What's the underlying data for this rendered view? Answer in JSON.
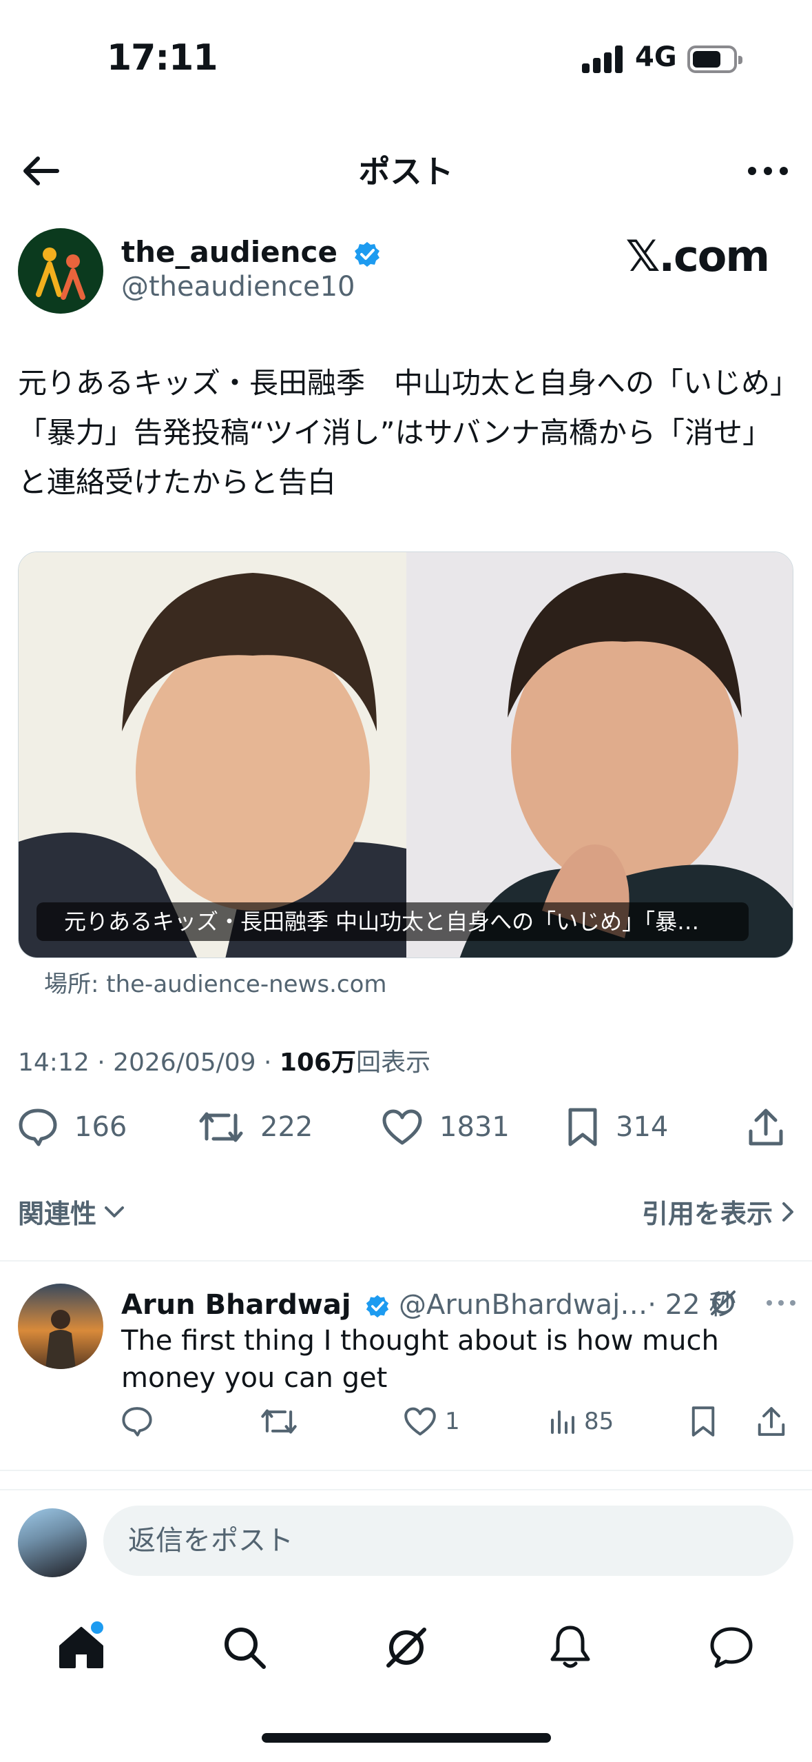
{
  "status_bar": {
    "time": "17:11",
    "network": "4G",
    "battery_level": 0.7
  },
  "header": {
    "title": "ポスト"
  },
  "post": {
    "author_name": "the_audience",
    "author_handle": "@theaudience10",
    "source_logo": "𝕏.com",
    "text": "元りあるキッズ・長田融季　中山功太と自身への「いじめ」「暴力」告発投稿“ツイ消し”はサバンナ高橋から「消せ」と連絡受けたからと告白",
    "media_caption": "元りあるキッズ・長田融季 中山功太と自身への「いじめ」「暴…",
    "media_source": "場所: the-audience-news.com",
    "timestamp": "14:12 · 2026/05/09 · ",
    "views_count": "106万",
    "views_label": "回表示",
    "replies": "166",
    "reposts": "222",
    "likes": "1831",
    "bookmarks": "314"
  },
  "filters": {
    "sort_label": "関連性",
    "quotes_label": "引用を表示"
  },
  "reply": {
    "name": "Arun Bhardwaj",
    "handle": "@ArunBhardwaj…",
    "time": "· 22 秒",
    "text": "The first thing I thought about is how much money you can get",
    "likes": "1",
    "views": "85"
  },
  "compose": {
    "placeholder": "返信をポスト"
  },
  "colors": {
    "accent": "#1d9bf0",
    "text": "#0f1419",
    "muted": "#536471",
    "divider": "#eff3f4"
  },
  "icons": [
    "back-arrow-icon",
    "more-icon",
    "verified-icon",
    "reply-icon",
    "repost-icon",
    "like-icon",
    "bookmark-icon",
    "share-icon",
    "chevron-down-icon",
    "chevron-right-icon",
    "grok-icon",
    "views-icon",
    "home-icon",
    "search-icon",
    "bell-icon",
    "messages-icon"
  ]
}
